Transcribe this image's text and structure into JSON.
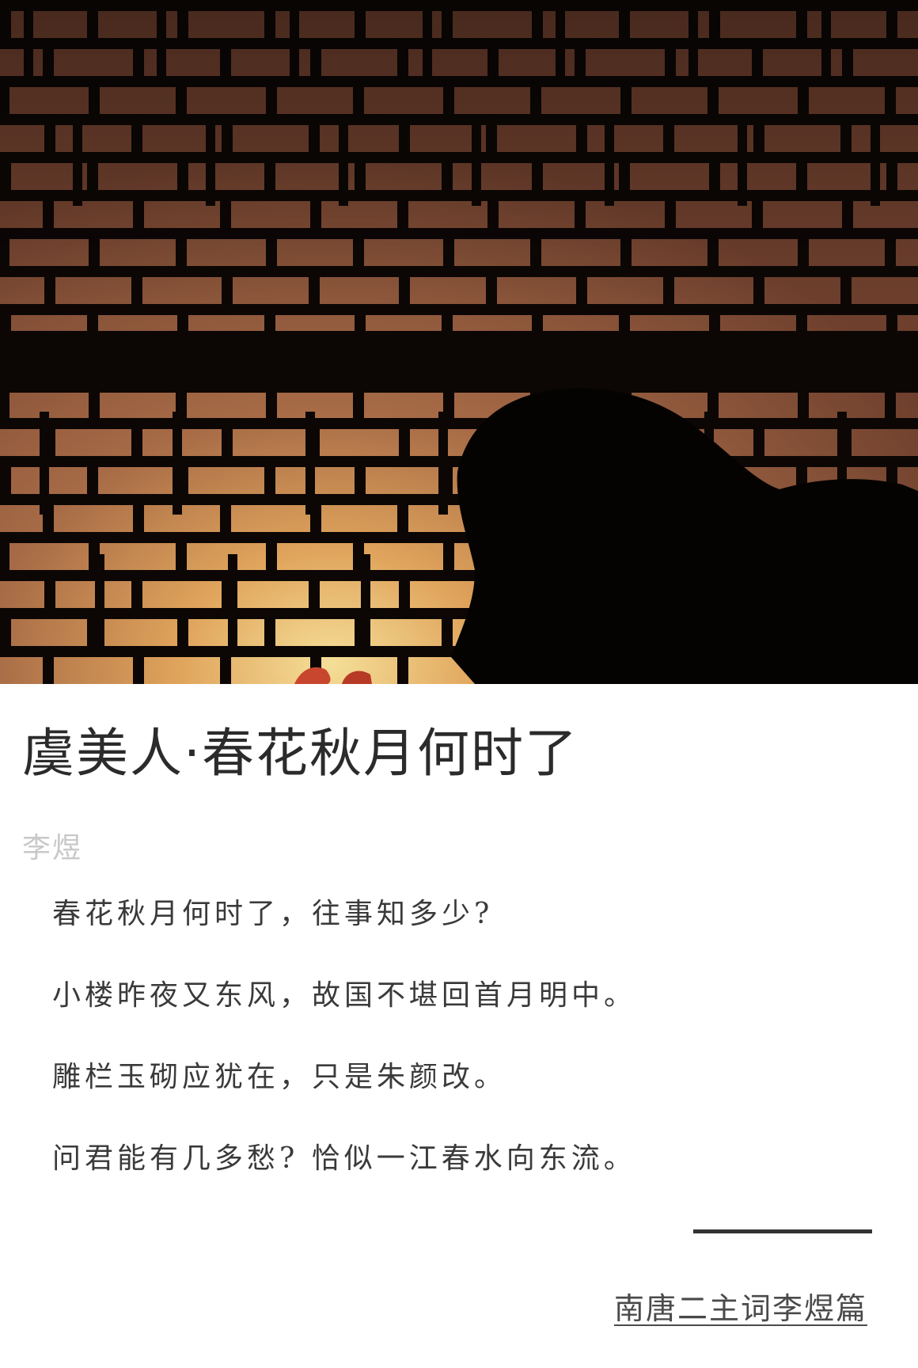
{
  "article": {
    "title": "虞美人·春花秋月何时了",
    "author": "李煜",
    "lines": [
      "春花秋月何时了，往事知多少?",
      "小楼昨夜又东风，故国不堪回首月明中。",
      "雕栏玉砌应犹在，只是朱颜改。",
      "问君能有几多愁? 恰似一江春水向东流。"
    ]
  },
  "footer": {
    "series_link": "南唐二主词李煜篇"
  },
  "colors": {
    "lattice_glow": "#f2d890",
    "lattice_wood": "#7a4a34",
    "lattice_dark": "#0c0705",
    "title_text": "#2b2b2b",
    "author_text": "#c8c8c8"
  }
}
